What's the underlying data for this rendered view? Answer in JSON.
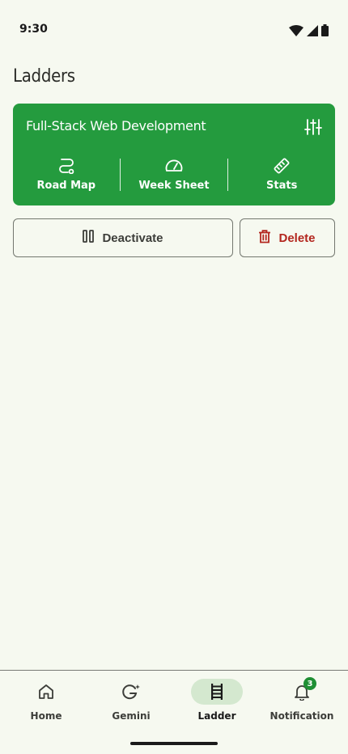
{
  "status_bar": {
    "time": "9:30"
  },
  "page": {
    "title": "Ladders"
  },
  "ladder_card": {
    "name": "Full-Stack Web Development",
    "actions": [
      {
        "label": "Road Map",
        "icon": "route-icon"
      },
      {
        "label": "Week Sheet",
        "icon": "speedometer-icon"
      },
      {
        "label": "Stats",
        "icon": "ruler-icon"
      }
    ],
    "color": "#249b3e"
  },
  "buttons": {
    "deactivate": "Deactivate",
    "delete": "Delete"
  },
  "bottom_nav": {
    "items": [
      {
        "label": "Home",
        "icon": "home-icon",
        "active": false
      },
      {
        "label": "Gemini",
        "icon": "gemini-icon",
        "active": false
      },
      {
        "label": "Ladder",
        "icon": "ladder-icon",
        "active": true
      },
      {
        "label": "Notification",
        "icon": "bell-icon",
        "active": false,
        "badge": "3"
      }
    ]
  },
  "colors": {
    "accent": "#249b3e",
    "danger": "#b3261e",
    "background": "#f6f9f0",
    "active_pill": "#d4e8cf"
  }
}
